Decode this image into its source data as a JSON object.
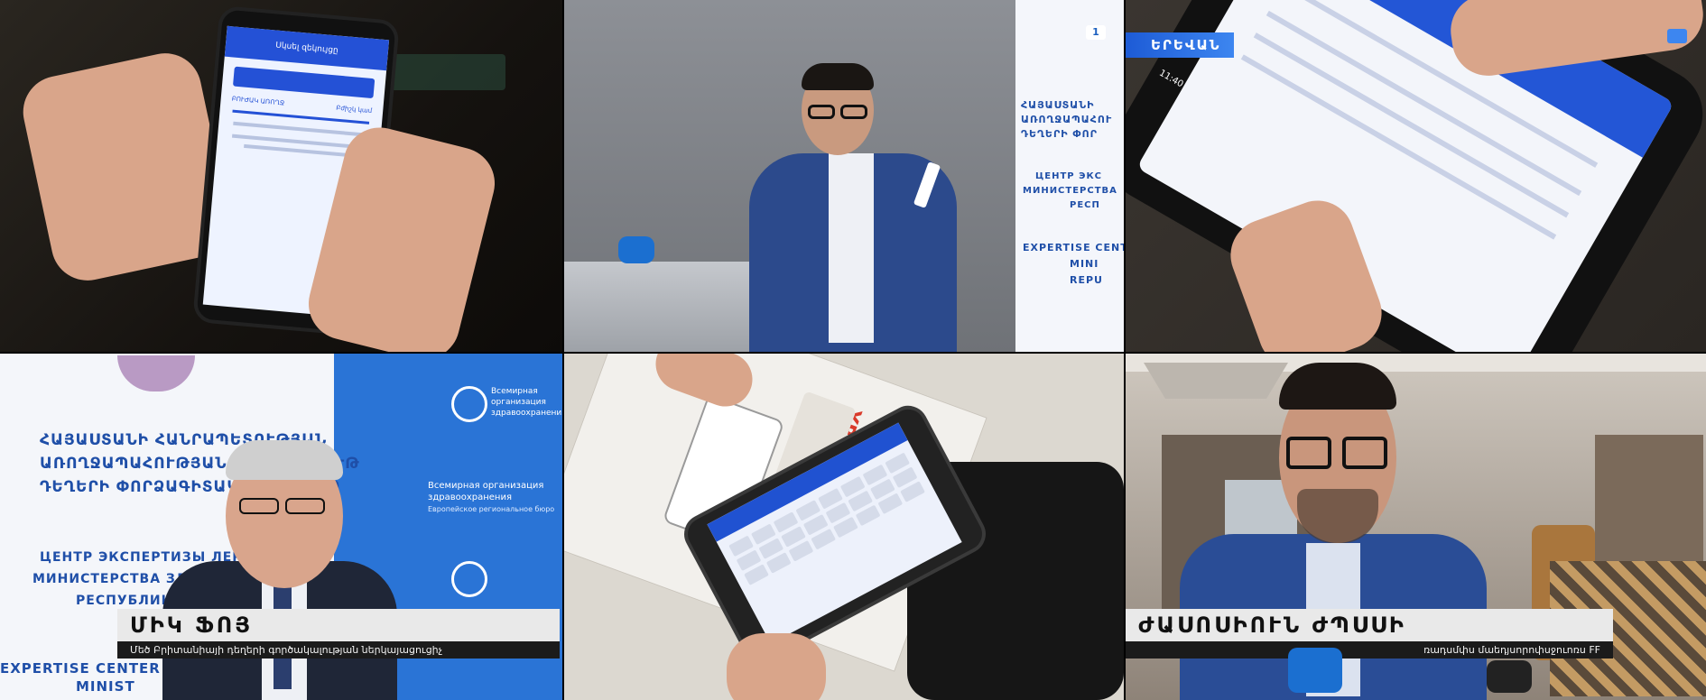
{
  "panels": {
    "p1": {
      "screen_header": "Սկսել զեկույցը",
      "screen_tab_left": "ԲՈՒԺԱԿ ԱՌՈՂՋ",
      "screen_tab_right": "Բժիշկ կամ"
    },
    "p2": {
      "banner_line1": "ՀԱՅԱՍՏԱՆԻ",
      "banner_line2": "ԱՌՈՂՋԱՊԱՀՈՒ",
      "banner_line3": "ԴԵՂԵՐԻ ՓՈՐ",
      "banner_ru1": "ЦЕНТР ЭКС",
      "banner_ru2": "МИНИСТЕРСТВА",
      "banner_ru3": "РЕСП",
      "banner_en1": "EXPERTISE CENT",
      "banner_en2": "MINI",
      "banner_en3": "REPU",
      "channel_logo": "1"
    },
    "p3": {
      "location": "ԵՐԵՎԱՆ",
      "time": "11:40"
    },
    "p4": {
      "banner_arm1": "ՀԱՅԱՍՏԱՆԻ ՀԱՆՐԱՊԵՏՈՒԹՅԱՆ",
      "banner_arm2": "ԱՌՈՂՋԱՊԱՀՈՒԹՅԱՆ ՆԱԽԱՐԱՐՈՒԹ",
      "banner_arm3": "ԴԵՂԵՐԻ ՓՈՐՁԱԳԻՏԱԿԱՆ ԿԵՆՏՐՈ",
      "banner_ru1": "ЦЕНТР ЭКСПЕРТИЗЫ ЛЕКАРСТ",
      "banner_ru2": "МИНИСТЕРСТВА ЗДРАВООХР",
      "banner_ru3": "РЕСПУБЛИКИ АР",
      "banner_en1": "EXPERTISE CENTER",
      "banner_en2": "MINIST",
      "who1": "Всемирная организация здравоохранения",
      "who2": "Европейское региональное бюро",
      "lower_name": "ՄԻԿ ՖՈՅ",
      "lower_title": "Մեծ Բրիտանիայի դեղերի գործակալության ներկայացուցիչ"
    },
    "p5": {
      "leaflet_title": "YRADR SAV"
    },
    "p6": {
      "lower_name": "ԺԱՍՈՍԻՈՒՆ ԺՊՍՍԻ",
      "lower_title": "ռադսմփս մաեդյսորոփսջուոռս FF"
    }
  }
}
